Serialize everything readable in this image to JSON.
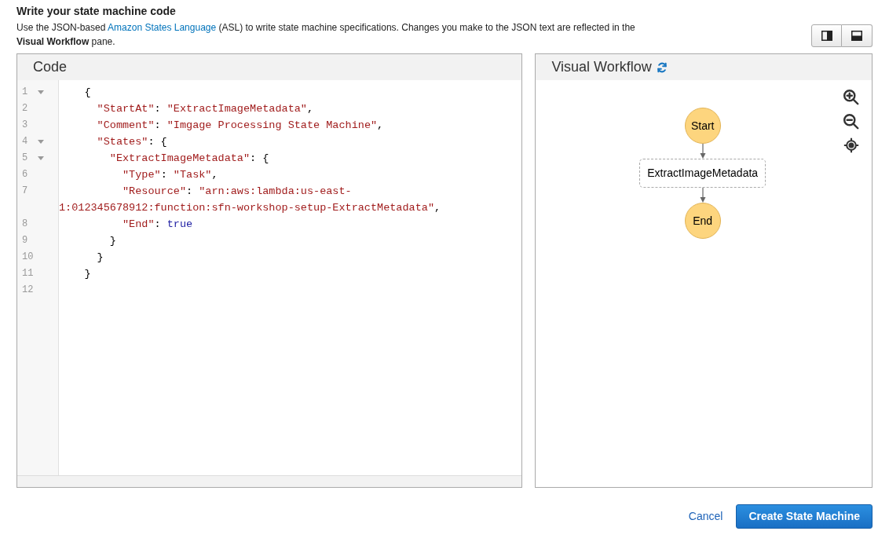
{
  "header": {
    "title": "Write your state machine code",
    "description_before": "Use the JSON-based ",
    "link": "Amazon States Language",
    "description_after": " (ASL) to write state machine specifications. Changes you make to the JSON text are reflected in the **Visual Workflow** pane."
  },
  "code_panel": {
    "title": "Code",
    "lines": [
      {
        "number": "1",
        "foldable": true,
        "tokens": [
          {
            "kind": "plain",
            "text": "    {"
          }
        ]
      },
      {
        "number": "2",
        "foldable": false,
        "tokens": [
          {
            "kind": "string",
            "text": "      \"StartAt\""
          },
          {
            "kind": "plain",
            "text": ": "
          },
          {
            "kind": "string",
            "text": "\"ExtractImageMetadata\""
          },
          {
            "kind": "plain",
            "text": ","
          }
        ]
      },
      {
        "number": "3",
        "foldable": false,
        "tokens": [
          {
            "kind": "string",
            "text": "      \"Comment\""
          },
          {
            "kind": "plain",
            "text": ": "
          },
          {
            "kind": "string",
            "text": "\"Imgage Processing State Machine\""
          },
          {
            "kind": "plain",
            "text": ","
          }
        ]
      },
      {
        "number": "4",
        "foldable": true,
        "tokens": [
          {
            "kind": "string",
            "text": "      \"States\""
          },
          {
            "kind": "plain",
            "text": ": {"
          }
        ]
      },
      {
        "number": "5",
        "foldable": true,
        "tokens": [
          {
            "kind": "string",
            "text": "        \"ExtractImageMetadata\""
          },
          {
            "kind": "plain",
            "text": ": {"
          }
        ]
      },
      {
        "number": "6",
        "foldable": false,
        "tokens": [
          {
            "kind": "string",
            "text": "          \"Type\""
          },
          {
            "kind": "plain",
            "text": ": "
          },
          {
            "kind": "string",
            "text": "\"Task\""
          },
          {
            "kind": "plain",
            "text": ","
          }
        ]
      },
      {
        "number": "7",
        "foldable": false,
        "tokens": [
          {
            "kind": "string",
            "text": "          \"Resource\""
          },
          {
            "kind": "plain",
            "text": ": "
          },
          {
            "kind": "string",
            "text": "\"arn:aws:lambda:us-east-1:012345678912:function:sfn-workshop-setup-ExtractMetadata\""
          },
          {
            "kind": "plain",
            "text": ","
          }
        ]
      },
      {
        "number": "8",
        "foldable": false,
        "tokens": [
          {
            "kind": "string",
            "text": "          \"End\""
          },
          {
            "kind": "plain",
            "text": ": "
          },
          {
            "kind": "keyword",
            "text": "true"
          }
        ]
      },
      {
        "number": "9",
        "foldable": false,
        "tokens": [
          {
            "kind": "plain",
            "text": "        }"
          }
        ]
      },
      {
        "number": "10",
        "foldable": false,
        "tokens": [
          {
            "kind": "plain",
            "text": "      }"
          }
        ]
      },
      {
        "number": "11",
        "foldable": false,
        "tokens": [
          {
            "kind": "plain",
            "text": "    }"
          }
        ]
      },
      {
        "number": "12",
        "foldable": false
      }
    ]
  },
  "workflow_panel": {
    "title": "Visual Workflow",
    "nodes": [
      {
        "kind": "terminal",
        "label": "Start"
      },
      {
        "kind": "task",
        "label": "ExtractImageMetadata"
      },
      {
        "kind": "terminal",
        "label": "End"
      }
    ]
  },
  "footer": {
    "cancel": "Cancel",
    "submit": "Create State Machine"
  }
}
